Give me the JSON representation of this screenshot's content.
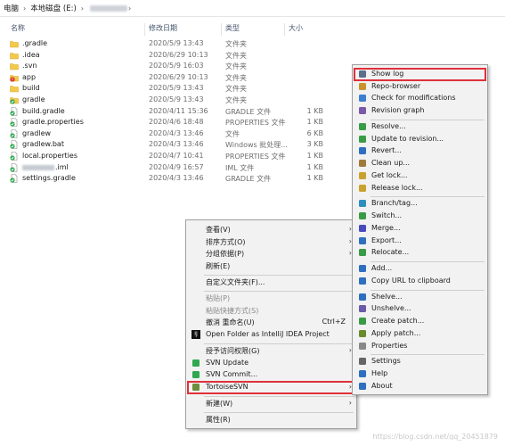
{
  "breadcrumb": {
    "items": [
      "电脑",
      "本地磁盘 (E:)"
    ]
  },
  "columns": {
    "name": "名称",
    "date": "修改日期",
    "type": "类型",
    "size": "大小"
  },
  "files": [
    {
      "name": ".gradle",
      "date": "2020/5/9 13:43",
      "type": "文件夹",
      "size": "",
      "icon": "folder-icon"
    },
    {
      "name": ".idea",
      "date": "2020/6/29 10:13",
      "type": "文件夹",
      "size": "",
      "icon": "folder-icon"
    },
    {
      "name": ".svn",
      "date": "2020/5/9 16:03",
      "type": "文件夹",
      "size": "",
      "icon": "folder-icon"
    },
    {
      "name": "app",
      "date": "2020/6/29 10:13",
      "type": "文件夹",
      "size": "",
      "icon": "svn-conflict-folder-icon"
    },
    {
      "name": "build",
      "date": "2020/5/9 13:43",
      "type": "文件夹",
      "size": "",
      "icon": "folder-icon"
    },
    {
      "name": "gradle",
      "date": "2020/5/9 13:43",
      "type": "文件夹",
      "size": "",
      "icon": "svn-ok-folder-icon"
    },
    {
      "name": "build.gradle",
      "date": "2020/4/11 15:36",
      "type": "GRADLE 文件",
      "size": "1 KB",
      "icon": "svn-ok-file-icon"
    },
    {
      "name": "gradle.properties",
      "date": "2020/4/6 18:48",
      "type": "PROPERTIES 文件",
      "size": "1 KB",
      "icon": "svn-ok-file-icon"
    },
    {
      "name": "gradlew",
      "date": "2020/4/3 13:46",
      "type": "文件",
      "size": "6 KB",
      "icon": "svn-ok-file-icon"
    },
    {
      "name": "gradlew.bat",
      "date": "2020/4/3 13:46",
      "type": "Windows 批处理...",
      "size": "3 KB",
      "icon": "svn-ok-file-icon"
    },
    {
      "name": "local.properties",
      "date": "2020/4/7 10:41",
      "type": "PROPERTIES 文件",
      "size": "1 KB",
      "icon": "svn-ok-file-icon"
    },
    {
      "name": ".iml",
      "date": "2020/4/9 16:57",
      "type": "IML 文件",
      "size": "1 KB",
      "icon": "svn-ok-file-icon",
      "blurred_prefix": true
    },
    {
      "name": "settings.gradle",
      "date": "2020/4/3 13:46",
      "type": "GRADLE 文件",
      "size": "1 KB",
      "icon": "svn-ok-file-icon"
    }
  ],
  "context_menu": {
    "items": [
      {
        "label": "查看(V)",
        "arrow": true
      },
      {
        "label": "排序方式(O)",
        "arrow": true
      },
      {
        "label": "分组依据(P)",
        "arrow": true
      },
      {
        "label": "刷新(E)"
      },
      {
        "sep": true
      },
      {
        "label": "自定义文件夹(F)..."
      },
      {
        "sep": true
      },
      {
        "label": "粘贴(P)",
        "disabled": true
      },
      {
        "label": "粘贴快捷方式(S)",
        "disabled": true
      },
      {
        "label": "撤消 重命名(U)",
        "shortcut": "Ctrl+Z"
      },
      {
        "label": "Open Folder as IntelliJ IDEA Project",
        "icon": "intellij-icon"
      },
      {
        "sep": true
      },
      {
        "label": "授予访问权限(G)",
        "arrow": true
      },
      {
        "label": "SVN Update",
        "icon": "svn-update-icon"
      },
      {
        "label": "SVN Commit...",
        "icon": "svn-commit-icon"
      },
      {
        "label": "TortoiseSVN",
        "icon": "tortoise-icon",
        "arrow": true,
        "highlighted": true
      },
      {
        "sep": true
      },
      {
        "label": "新建(W)",
        "arrow": true
      },
      {
        "sep": true
      },
      {
        "label": "属性(R)"
      }
    ]
  },
  "svn_menu": {
    "items": [
      {
        "label": "Show log",
        "icon": "show-log-icon",
        "highlighted": true
      },
      {
        "label": "Repo-browser",
        "icon": "repo-browser-icon"
      },
      {
        "label": "Check for modifications",
        "icon": "check-modifications-icon"
      },
      {
        "label": "Revision graph",
        "icon": "revision-graph-icon"
      },
      {
        "sep": true
      },
      {
        "label": "Resolve...",
        "icon": "resolve-icon"
      },
      {
        "label": "Update to revision...",
        "icon": "update-revision-icon"
      },
      {
        "label": "Revert...",
        "icon": "revert-icon"
      },
      {
        "label": "Clean up...",
        "icon": "cleanup-icon"
      },
      {
        "label": "Get lock...",
        "icon": "get-lock-icon"
      },
      {
        "label": "Release lock...",
        "icon": "release-lock-icon"
      },
      {
        "sep": true
      },
      {
        "label": "Branch/tag...",
        "icon": "branch-tag-icon"
      },
      {
        "label": "Switch...",
        "icon": "switch-icon"
      },
      {
        "label": "Merge...",
        "icon": "merge-icon"
      },
      {
        "label": "Export...",
        "icon": "export-icon"
      },
      {
        "label": "Relocate...",
        "icon": "relocate-icon"
      },
      {
        "sep": true
      },
      {
        "label": "Add...",
        "icon": "add-icon"
      },
      {
        "label": "Copy URL to clipboard",
        "icon": "copy-url-icon"
      },
      {
        "sep": true
      },
      {
        "label": "Shelve...",
        "icon": "shelve-icon"
      },
      {
        "label": "Unshelve...",
        "icon": "unshelve-icon"
      },
      {
        "label": "Create patch...",
        "icon": "create-patch-icon"
      },
      {
        "label": "Apply patch...",
        "icon": "apply-patch-icon"
      },
      {
        "label": "Properties",
        "icon": "properties-icon"
      },
      {
        "sep": true
      },
      {
        "label": "Settings",
        "icon": "settings-icon"
      },
      {
        "label": "Help",
        "icon": "help-icon"
      },
      {
        "label": "About",
        "icon": "about-icon"
      }
    ]
  },
  "watermark": "https://blog.csdn.net/qq_20451879",
  "colors": {
    "highlight_border": "#e0303a",
    "folder": "#f3c94b",
    "svn_ok": "#2fa84f",
    "svn_conflict": "#d9342b"
  }
}
